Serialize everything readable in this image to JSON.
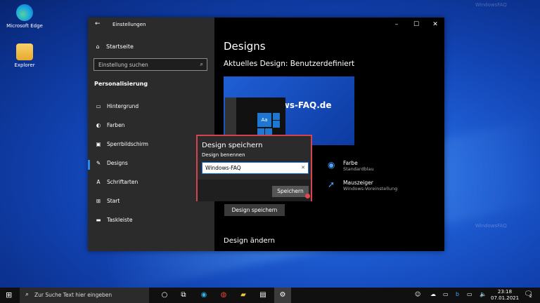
{
  "desktop": {
    "icons": [
      {
        "label": "Microsoft Edge",
        "icon": "edge-icon"
      },
      {
        "label": "Explorer",
        "icon": "folder-icon"
      }
    ],
    "watermark": "WindowsFAQ"
  },
  "settings": {
    "title": "Einstellungen",
    "home_label": "Startseite",
    "search_placeholder": "Einstellung suchen",
    "section_heading": "Personalisierung",
    "nav_items": [
      {
        "label": "Hintergrund",
        "icon": "image-icon"
      },
      {
        "label": "Farben",
        "icon": "palette-icon"
      },
      {
        "label": "Sperrbildschirm",
        "icon": "lockscreen-icon"
      },
      {
        "label": "Designs",
        "icon": "brush-icon",
        "active": true
      },
      {
        "label": "Schriftarten",
        "icon": "font-icon"
      },
      {
        "label": "Start",
        "icon": "start-icon"
      },
      {
        "label": "Taskleiste",
        "icon": "taskbar-icon"
      }
    ],
    "main": {
      "heading": "Designs",
      "current_design": "Aktuelles Design: Benutzerdefiniert",
      "preview_watermark": "Windows-FAQ.de",
      "preview_tile": "Aa",
      "properties": [
        {
          "name": "Farbe",
          "value": "Standardblau",
          "icon": "palette-icon"
        },
        {
          "name": "Mauszeiger",
          "value": "Windows-Voreinstellung",
          "icon": "cursor-icon"
        }
      ],
      "save_design_button": "Design speichern",
      "change_design_heading": "Design ändern"
    }
  },
  "dialog": {
    "title": "Design speichern",
    "field_label": "Design benennen",
    "field_value": "Windows-FAQ",
    "save_button": "Speichern"
  },
  "taskbar": {
    "search_placeholder": "Zur Suche Text hier eingeben",
    "time": "23:18",
    "date": "07.01.2021",
    "notification_count": "2"
  },
  "colors": {
    "accent": "#1a73d9",
    "dialog_highlight": "#d4434f"
  }
}
